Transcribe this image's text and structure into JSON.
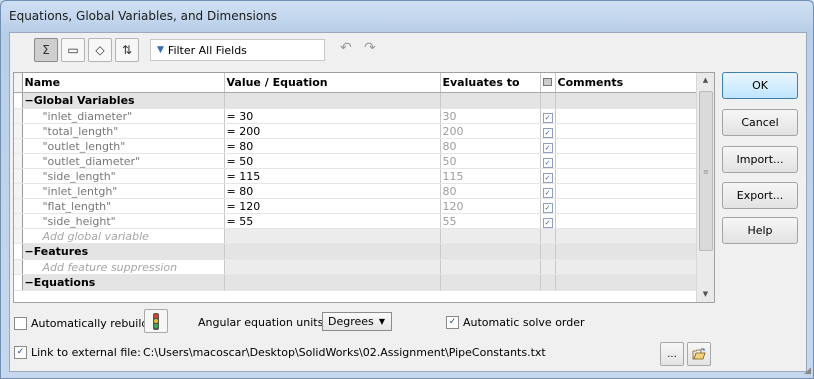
{
  "window": {
    "title": "Equations, Global Variables, and Dimensions"
  },
  "toolbar": {
    "buttons": [
      {
        "icon": "sigma-equation-view-icon",
        "glyph": "Σ",
        "pressed": true
      },
      {
        "icon": "sketch-equation-view-icon",
        "glyph": "▭",
        "pressed": false
      },
      {
        "icon": "dimension-view-icon",
        "glyph": "◇",
        "pressed": false
      },
      {
        "icon": "ordered-view-icon",
        "glyph": "⇅",
        "pressed": false
      }
    ],
    "filter_placeholder": "Filter All Fields",
    "filter_icon": "funnel-icon",
    "undo_glyph": "↶",
    "redo_glyph": "↷"
  },
  "grid": {
    "columns": [
      "Name",
      "Value / Equation",
      "Evaluates to",
      "Comments"
    ],
    "sections": {
      "global_variables": "Global Variables",
      "features": "Features",
      "equations": "Equations"
    },
    "rows": [
      {
        "name": "\"inlet_diameter\"",
        "value": "= 30",
        "evaluates": "30",
        "checked": true
      },
      {
        "name": "\"total_length\"",
        "value": "= 200",
        "evaluates": "200",
        "checked": true
      },
      {
        "name": "\"outlet_length\"",
        "value": "= 80",
        "evaluates": "80",
        "checked": true
      },
      {
        "name": "\"outlet_diameter\"",
        "value": "= 50",
        "evaluates": "50",
        "checked": true
      },
      {
        "name": "\"side_length\"",
        "value": "= 115",
        "evaluates": "115",
        "checked": true
      },
      {
        "name": "\"inlet_lentgh\"",
        "value": "= 80",
        "evaluates": "80",
        "checked": true
      },
      {
        "name": "\"flat_length\"",
        "value": "= 120",
        "evaluates": "120",
        "checked": true
      },
      {
        "name": "\"side_height\"",
        "value": "= 55",
        "evaluates": "55",
        "checked": true
      }
    ],
    "add_global_variable": "Add global variable",
    "add_feature_suppression": "Add feature suppression",
    "collapse_glyph": "−"
  },
  "buttons": {
    "ok": "OK",
    "cancel": "Cancel",
    "import": "Import...",
    "export": "Export...",
    "help": "Help"
  },
  "bottom": {
    "auto_rebuild": {
      "label": "Automatically rebuild",
      "checked": false
    },
    "angular_units_label": "Angular equation units:",
    "angular_units_value": "Degrees",
    "auto_solve": {
      "label": "Automatic solve order",
      "checked": true
    },
    "link_external": {
      "label": "Link to external file:",
      "checked": true
    },
    "external_path": "C:\\Users\\macoscar\\Desktop\\SolidWorks\\02.Assignment\\PipeConstants.txt",
    "browse_label": "...",
    "check_glyph": "✓"
  },
  "colors": {
    "accent": "#3c7fb1",
    "title_bg": "#c6d8ee"
  }
}
